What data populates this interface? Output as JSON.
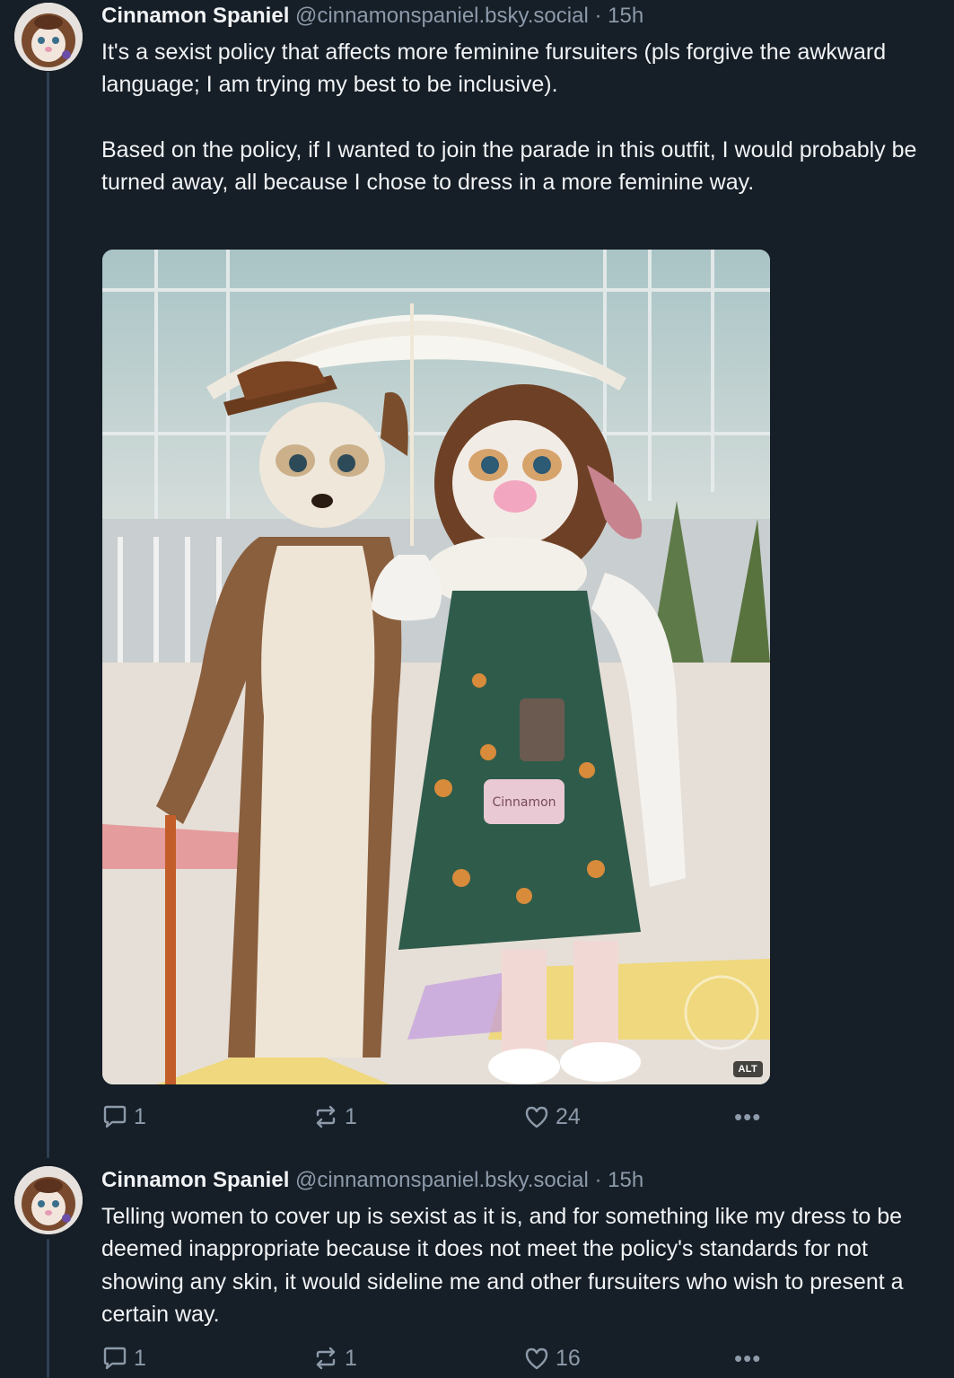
{
  "posts": [
    {
      "author": {
        "display_name": "Cinnamon Spaniel",
        "handle": "@cinnamonspaniel.bsky.social",
        "separator": "·",
        "time": "15h"
      },
      "paragraphs": [
        "It's a sexist policy that affects more feminine fursuiters (pls forgive the awkward language; I am trying my best to be inclusive).",
        "Based on the policy, if I wanted to join the parade in this outfit, I would probably be turned away, all because I chose to dress in a more feminine way."
      ],
      "media": {
        "alt_badge": "ALT",
        "overlay_text": "Cinnamon"
      },
      "stats": {
        "replies": "1",
        "reposts": "1",
        "likes": "24"
      }
    },
    {
      "author": {
        "display_name": "Cinnamon Spaniel",
        "handle": "@cinnamonspaniel.bsky.social",
        "separator": "·",
        "time": "15h"
      },
      "paragraphs": [
        "Telling women to cover up is sexist as it is, and for something like my dress to be deemed inappropriate because it does not meet the policy's standards for not showing any skin, it would sideline me and other fursuiters who wish to present a certain way."
      ],
      "stats": {
        "replies": "1",
        "reposts": "1",
        "likes": "16"
      }
    }
  ],
  "icons": {
    "reply": "speech-bubble-icon",
    "repost": "repost-arrows-icon",
    "like": "heart-icon",
    "more": "more-options-icon"
  },
  "colors": {
    "background": "#161e27",
    "text": "#f1f3f5",
    "muted": "#8c9aaa",
    "thread_line": "#2e4052"
  }
}
